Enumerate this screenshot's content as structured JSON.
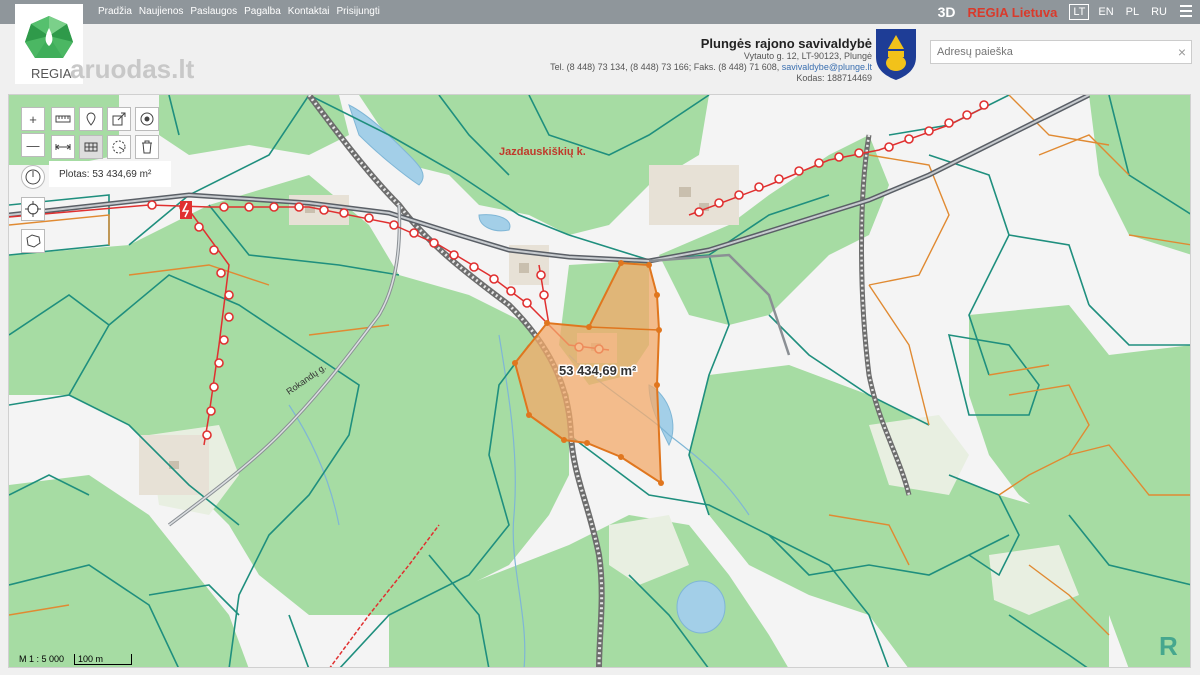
{
  "topbar": {
    "nav": [
      "Pradžia",
      "Naujienos",
      "Paslaugos",
      "Pagalba",
      "Kontaktai",
      "Prisijungti"
    ],
    "mode_3d": "3D",
    "brand": "REGIA Lietuva",
    "languages": [
      "LT",
      "EN",
      "PL",
      "RU"
    ],
    "active_language": "LT"
  },
  "logo": {
    "text": "REGIA"
  },
  "watermark": "aruodas.lt",
  "municipality": {
    "name": "Plungės rajono savivaldybė",
    "address": "Vytauto g. 12, LT-90123, Plungė",
    "phones": "Tel. (8 448) 73 134, (8 448) 73 166; Faks. (8 448) 71 608,",
    "email": "savivaldybe@plunge.lt",
    "code": "Kodas: 188714469"
  },
  "search": {
    "placeholder": "Adresų paieška",
    "clear": "×"
  },
  "map": {
    "village_label": "Jazdauskiškių k.",
    "road_label": "Rokandų g.",
    "area_label": "53 434,69 m²",
    "area_panel": "Plotas: 53 434,69 m²",
    "scale": "M 1 : 5 000",
    "scale_bar": "100 m",
    "colors": {
      "forest": "#a6dca3",
      "meadow": "#f4f4f4",
      "parcel_teal": "#1f8f7e",
      "parcel_orange": "#e08a32",
      "power_line": "#e03030",
      "water": "#a3cfe8",
      "selection": "#f3a96a"
    }
  },
  "tools": {
    "zoom_in": "+",
    "zoom_out": "—"
  }
}
